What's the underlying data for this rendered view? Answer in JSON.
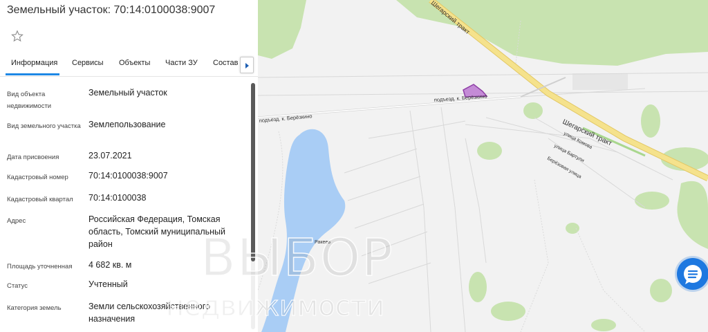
{
  "panel": {
    "title": "Земельный участок: 70:14:0100038:9007",
    "tabs": [
      "Информация",
      "Сервисы",
      "Объекты",
      "Части ЗУ",
      "Состав"
    ],
    "active_tab": "Информация",
    "fields": [
      {
        "label": "Вид объекта недвижимости",
        "value": "Земельный участок"
      },
      {
        "label": "Вид земельного участка",
        "value": "Землепользование"
      },
      {
        "label": "Дата присвоения",
        "value": "23.07.2021"
      },
      {
        "label": "Кадастровый номер",
        "value": "70:14:0100038:9007"
      },
      {
        "label": "Кадастровый квартал",
        "value": "70:14:0100038"
      },
      {
        "label": "Адрес",
        "value": "Российская Федерация, Томская область, Томский муниципальный район"
      },
      {
        "label": "Площадь уточненная",
        "value": "4 682 кв. м"
      },
      {
        "label": "Статус",
        "value": "Учтенный"
      },
      {
        "label": "Категория земель",
        "value": "Земли сельскохозяйственного назначения"
      }
    ]
  },
  "map": {
    "labels": {
      "road_top": "Шегарский тракт",
      "road_main": "Шегарский тракт",
      "access_road_right": "подъезд. к. Берёзкино",
      "access_road_left": "подъезд. к. Берёзкино",
      "street_komova": "улица Комова",
      "street_bartuli": "улица Бартули",
      "street_berezovaya": "Берёзовая улица",
      "lake": "Ракеев"
    },
    "colors": {
      "background": "#f2f2f2",
      "forest": "#c8e3b0",
      "water": "#a9cdf5",
      "road": "#f5e28c",
      "parcel": "#c48bd6"
    }
  },
  "watermark": {
    "line1": "ВЫБОР",
    "line2": "недвижимости"
  }
}
